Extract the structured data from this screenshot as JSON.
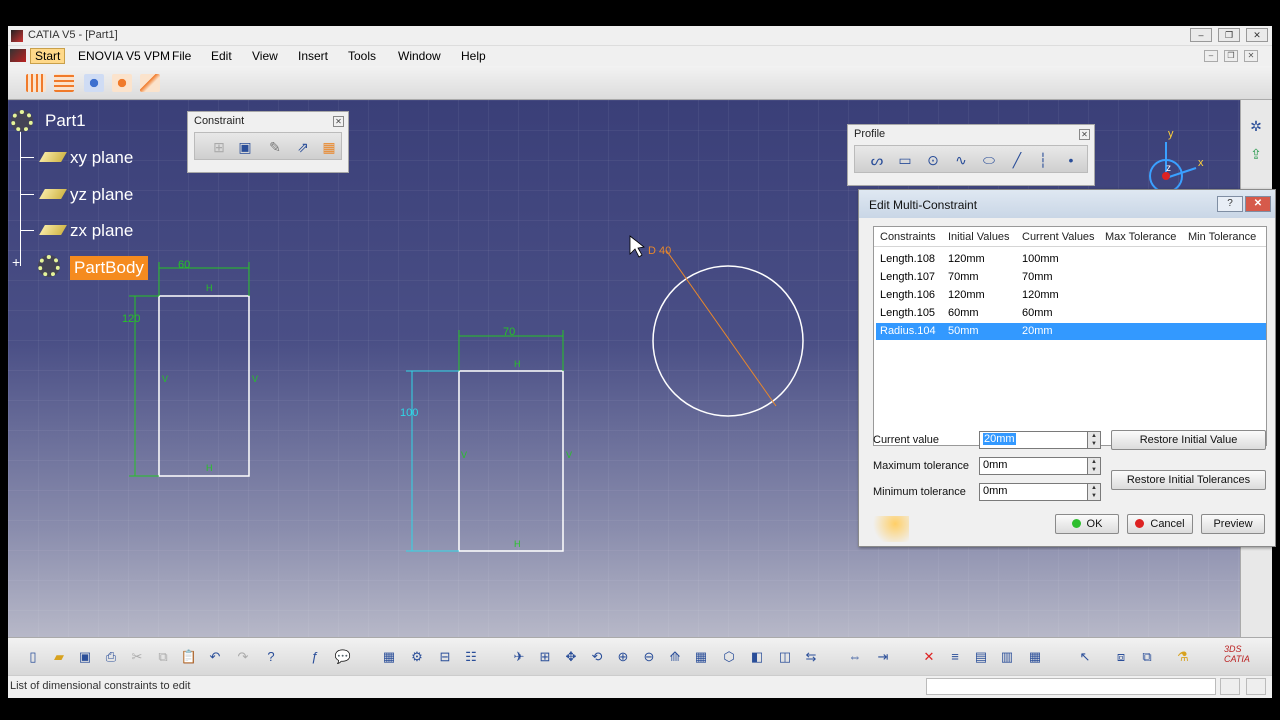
{
  "window": {
    "title": "CATIA V5 - [Part1]",
    "controls": [
      "‒",
      "❐",
      "✕"
    ]
  },
  "menu": {
    "items": [
      "Start",
      "ENOVIA V5 VPM",
      "File",
      "Edit",
      "View",
      "Insert",
      "Tools",
      "Window",
      "Help"
    ]
  },
  "tree": {
    "root": "Part1",
    "items": [
      "xy plane",
      "yz plane",
      "zx plane"
    ],
    "body": "PartBody"
  },
  "constraint_toolbar": {
    "title": "Constraint"
  },
  "profile_toolbar": {
    "title": "Profile"
  },
  "axis": {
    "y": "y",
    "z": "z",
    "x": "x"
  },
  "sketch": {
    "rect1_width": "60",
    "rect1_height": "120",
    "rect2_width": "70",
    "rect2_height": "100",
    "circle_dim": "D 40",
    "marks": {
      "h": "H",
      "v": "V"
    }
  },
  "dialog": {
    "title": "Edit Multi-Constraint",
    "columns": [
      "Constraints",
      "Initial Values",
      "Current Values",
      "Max Tolerance",
      "Min Tolerance"
    ],
    "rows": [
      {
        "name": "Length.108",
        "initial": "120mm",
        "current": "100mm"
      },
      {
        "name": "Length.107",
        "initial": "70mm",
        "current": "70mm"
      },
      {
        "name": "Length.106",
        "initial": "120mm",
        "current": "120mm"
      },
      {
        "name": "Length.105",
        "initial": "60mm",
        "current": "60mm"
      },
      {
        "name": "Radius.104",
        "initial": "50mm",
        "current": "20mm",
        "selected": true
      }
    ],
    "current_value_label": "Current value",
    "current_value": "20mm",
    "max_tol_label": "Maximum tolerance",
    "max_tol": "0mm",
    "min_tol_label": "Minimum tolerance",
    "min_tol": "0mm",
    "restore_value": "Restore Initial Value",
    "restore_tolerances": "Restore Initial Tolerances",
    "ok": "OK",
    "cancel": "Cancel",
    "preview": "Preview"
  },
  "status": {
    "text": "List of dimensional constraints to edit"
  },
  "colors": {
    "viewport_top": "#3a3f78",
    "selection": "#3399ff",
    "partbody": "#f58b1f",
    "dim_green": "#25c425",
    "dim_cyan": "#2fd6e6",
    "dim_orange": "#e8872b"
  }
}
